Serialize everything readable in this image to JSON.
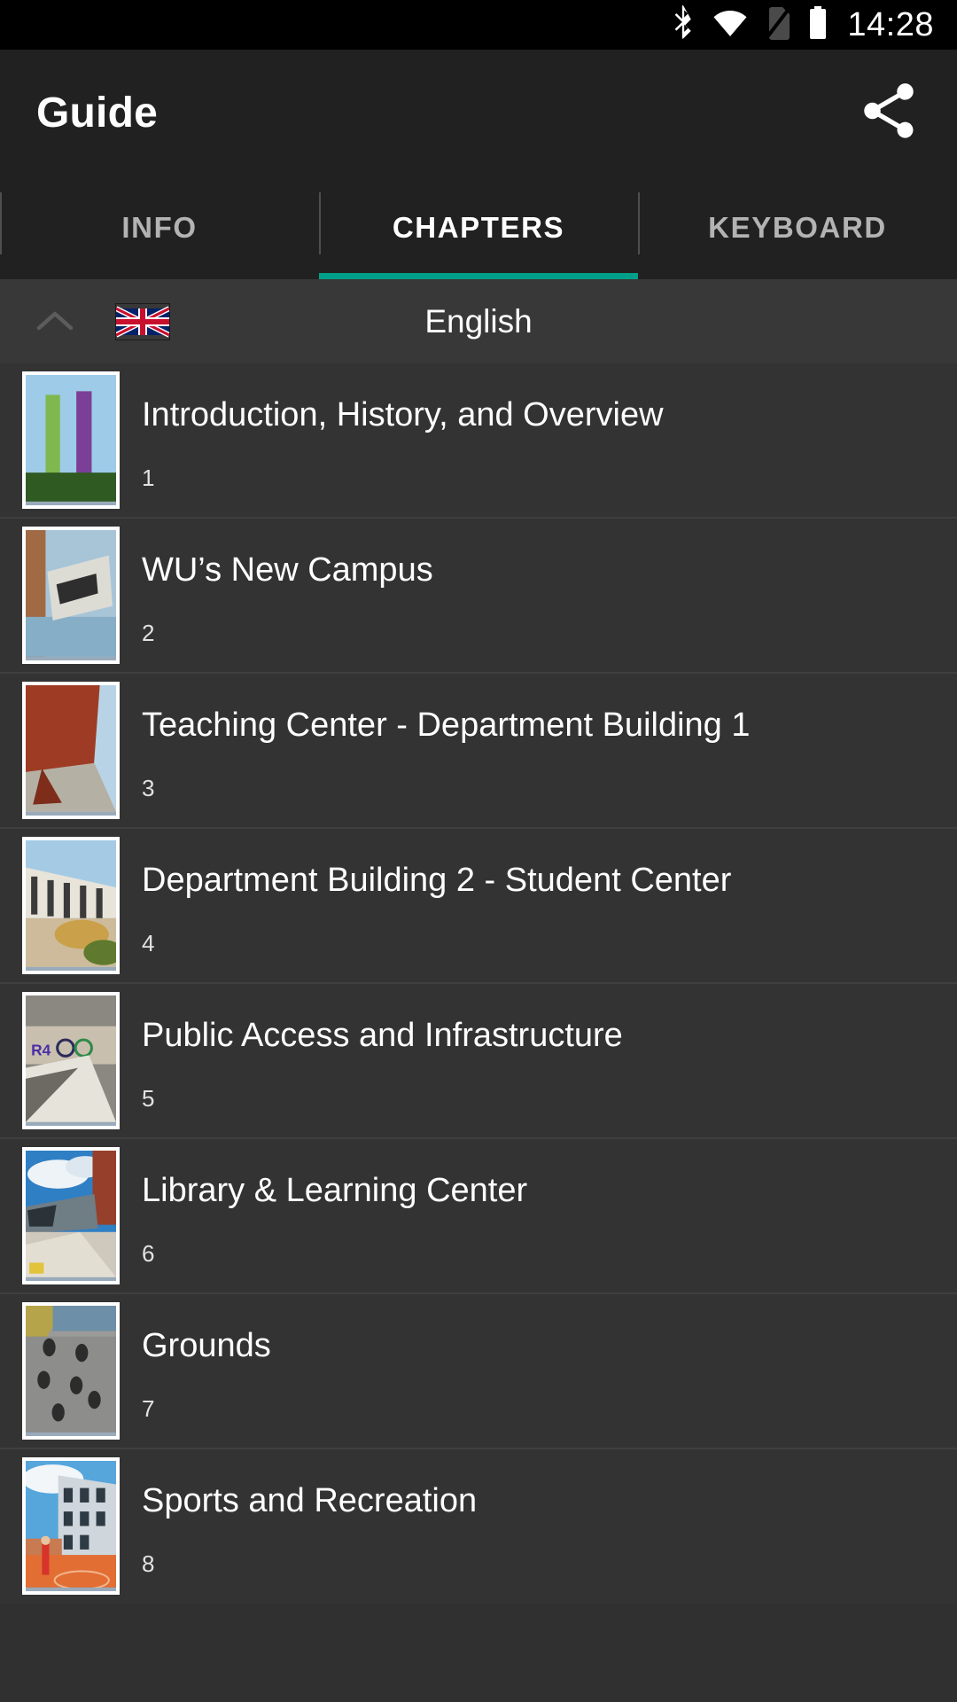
{
  "statusbar": {
    "time": "14:28",
    "icons": [
      "bluetooth-icon",
      "wifi-icon",
      "no-sim-icon",
      "battery-icon"
    ]
  },
  "appbar": {
    "title": "Guide",
    "share_label": "share-icon"
  },
  "tabs": {
    "items": [
      {
        "label": "INFO",
        "active": false
      },
      {
        "label": "CHAPTERS",
        "active": true
      },
      {
        "label": "KEYBOARD",
        "active": false
      }
    ],
    "active_index": 1,
    "indicator_color": "#00a08a"
  },
  "language": {
    "name": "English",
    "flag": "uk-flag-icon",
    "chevron": "chevron-up-icon"
  },
  "chapters": [
    {
      "title": "Introduction, History, and Overview",
      "number": "1"
    },
    {
      "title": "WU’s New Campus",
      "number": "2"
    },
    {
      "title": "Teaching Center - Department Building 1",
      "number": "3"
    },
    {
      "title": "Department Building 2 - Student Center",
      "number": "4"
    },
    {
      "title": "Public Access and Infrastructure",
      "number": "5"
    },
    {
      "title": "Library & Learning Center",
      "number": "6"
    },
    {
      "title": "Grounds",
      "number": "7"
    },
    {
      "title": "Sports and Recreation",
      "number": "8"
    }
  ],
  "colors": {
    "statusbar_bg": "#000000",
    "appbar_bg": "#212121",
    "list_bg": "#333333",
    "lang_bg": "#383838",
    "accent": "#00a08a"
  }
}
